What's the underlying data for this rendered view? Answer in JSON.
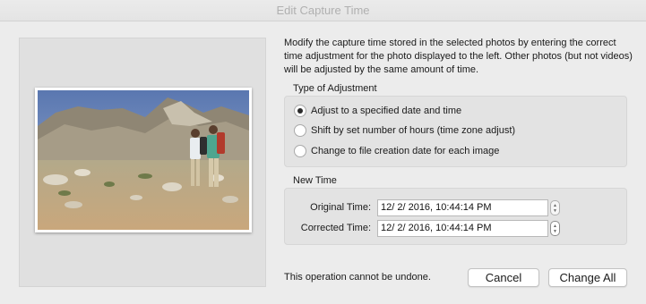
{
  "window": {
    "title": "Edit Capture Time"
  },
  "description": "Modify the capture time stored in the selected photos by entering the correct time adjustment for the photo displayed to the left. Other photos (but not videos) will be adjusted by the same amount of time.",
  "adjustment": {
    "title": "Type of Adjustment",
    "options": [
      {
        "label": "Adjust to a specified date and time",
        "selected": true
      },
      {
        "label": "Shift by set number of hours (time zone adjust)",
        "selected": false
      },
      {
        "label": "Change to file creation date for each image",
        "selected": false
      }
    ]
  },
  "new_time": {
    "title": "New Time",
    "original_label": "Original Time:",
    "original_value": "12/  2/ 2016, 10:44:14 PM",
    "corrected_label": "Corrected Time:",
    "corrected_value": "12/  2/ 2016, 10:44:14 PM"
  },
  "footer": {
    "warning": "This operation cannot be undone.",
    "cancel_label": "Cancel",
    "change_all_label": "Change All"
  },
  "icons": {
    "photo": "hikers-mountain-photo",
    "stepper": "stepper-arrows-icon"
  }
}
